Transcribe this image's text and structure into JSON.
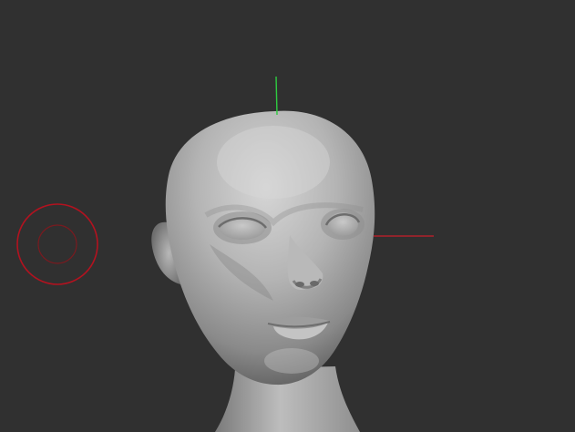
{
  "viewport": {
    "background": "#303030"
  },
  "model": {
    "name": "sculpted-head",
    "surface_color": "#a9a9a9"
  },
  "gizmo": {
    "y_axis_color": "#2ecc40",
    "x_axis_color": "#b0202a"
  },
  "brush": {
    "cursor_color": "#b3121f"
  }
}
